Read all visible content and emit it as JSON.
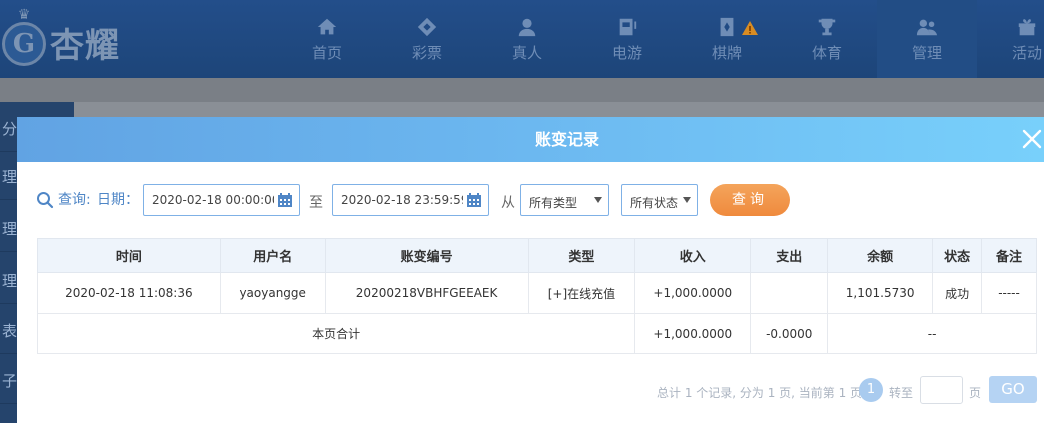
{
  "brand": {
    "name": "杏耀",
    "crest_letter": "G"
  },
  "nav": {
    "items": [
      {
        "label": "首页",
        "icon": "home-icon"
      },
      {
        "label": "彩票",
        "icon": "lottery-ticket-icon"
      },
      {
        "label": "真人",
        "icon": "dealer-icon"
      },
      {
        "label": "电游",
        "icon": "slot-machine-icon"
      },
      {
        "label": "棋牌",
        "icon": "playing-card-icon"
      },
      {
        "label": "体育",
        "icon": "trophy-icon"
      },
      {
        "label": "管理",
        "icon": "users-icon"
      },
      {
        "label": "活动",
        "icon": "gift-icon"
      }
    ]
  },
  "side": {
    "items": [
      "分",
      "理",
      "理",
      "理",
      "表",
      "子体"
    ]
  },
  "modal": {
    "title": "账变记录",
    "filters": {
      "query_label": "查询:",
      "date_label": "日期：",
      "start_date": "2020-02-18 00:00:00",
      "to_label": "至",
      "end_date": "2020-02-18 23:59:59",
      "from_label": "从",
      "type_select": "所有类型",
      "status_select": "所有状态",
      "query_button": "查询"
    },
    "table": {
      "headers": [
        "时间",
        "用户名",
        "账变编号",
        "类型",
        "收入",
        "支出",
        "余额",
        "状态",
        "备注"
      ],
      "rows": [
        {
          "time": "2020-02-18 11:08:36",
          "username": "yaoyangge",
          "txn_id": "20200218VBHFGEEAEK",
          "type": "[+]在线充值",
          "income": "+1,000.0000",
          "expense": "",
          "balance": "1,101.5730",
          "status": "成功",
          "note": "-----"
        }
      ],
      "total": {
        "label": "本页合计",
        "income": "+1,000.0000",
        "expense": "-0.0000",
        "rest": "--"
      }
    },
    "pager": {
      "summary": "总计 1 个记录, 分为 1 页, 当前第 1 页",
      "current_page": "1",
      "jump_label": "转至",
      "jump_value": "",
      "page_unit": "页",
      "go_button": "GO"
    }
  },
  "colors": {
    "header_gradient_start": "#61a3e3",
    "header_gradient_end": "#78d0fb",
    "query_button": "#ef8a3d",
    "income_positive": "#3a8a3a",
    "nav_background": "#234e8a"
  }
}
